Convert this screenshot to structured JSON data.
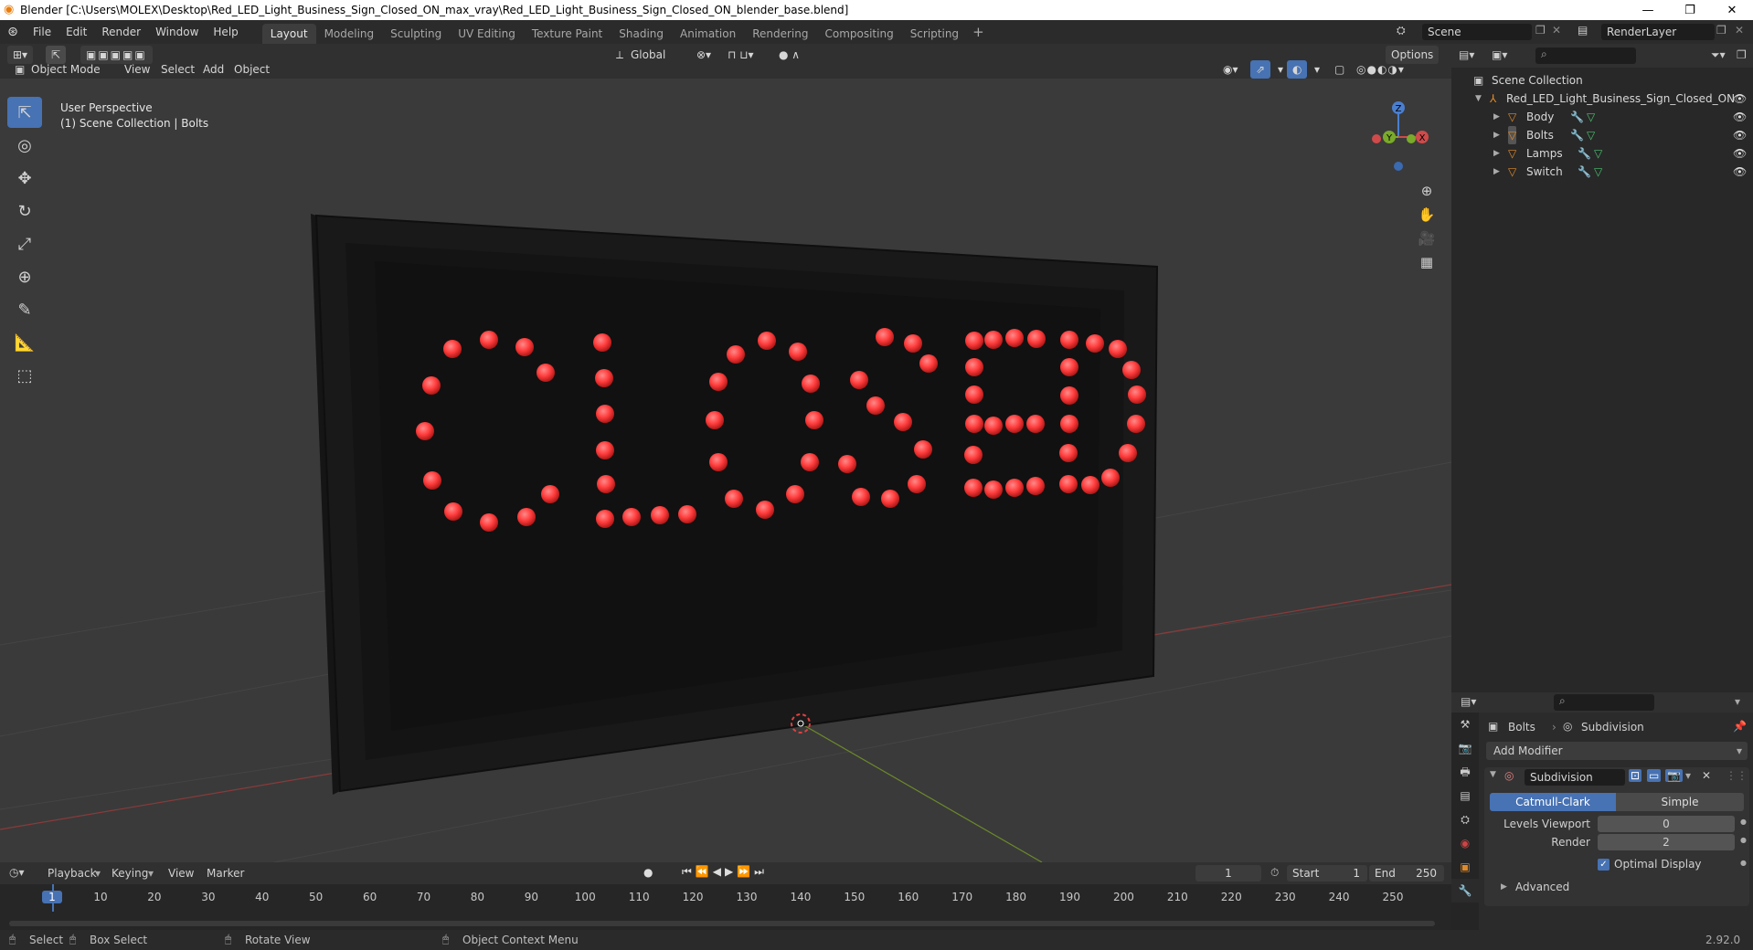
{
  "window": {
    "title": "Blender [C:\\Users\\MOLEX\\Desktop\\Red_LED_Light_Business_Sign_Closed_ON_max_vray\\Red_LED_Light_Business_Sign_Closed_ON_blender_base.blend]",
    "minimize": "—",
    "maximize": "❐",
    "close": "✕"
  },
  "menu": [
    "File",
    "Edit",
    "Render",
    "Window",
    "Help"
  ],
  "workspaces": [
    "Layout",
    "Modeling",
    "Sculpting",
    "UV Editing",
    "Texture Paint",
    "Shading",
    "Animation",
    "Rendering",
    "Compositing",
    "Scripting"
  ],
  "scene": {
    "name": "Scene",
    "render_layer": "RenderLayer"
  },
  "viewport": {
    "mode": "Object Mode",
    "menus": [
      "View",
      "Select",
      "Add",
      "Object"
    ],
    "transform_orientation": "Global",
    "options": "Options",
    "info_line1": "User Perspective",
    "info_line2": "(1) Scene Collection | Bolts",
    "gizmo": {
      "x": "X",
      "y": "Y",
      "z": "Z"
    },
    "sign_text": "CLOSED",
    "led_color": "#ff4040"
  },
  "outliner": {
    "root": "Scene Collection",
    "collection": "Red_LED_Light_Business_Sign_Closed_ON",
    "objects": [
      "Body",
      "Bolts",
      "Lamps",
      "Switch"
    ]
  },
  "properties": {
    "object": "Bolts",
    "modifier_name": "Subdivision",
    "add_modifier": "Add Modifier",
    "mod_types": [
      "Catmull-Clark",
      "Simple"
    ],
    "levels_viewport_label": "Levels Viewport",
    "levels_viewport": "0",
    "render_label": "Render",
    "render": "2",
    "optimal_display": "Optimal Display",
    "advanced": "Advanced"
  },
  "timeline": {
    "menus": [
      "Playback",
      "Keying",
      "View",
      "Marker"
    ],
    "current_frame": "1",
    "start_label": "Start",
    "start": "1",
    "end_label": "End",
    "end": "250",
    "ticks": [
      "1",
      "10",
      "20",
      "30",
      "40",
      "50",
      "60",
      "70",
      "80",
      "90",
      "100",
      "110",
      "120",
      "130",
      "140",
      "150",
      "160",
      "170",
      "180",
      "190",
      "200",
      "210",
      "220",
      "230",
      "240",
      "250"
    ]
  },
  "status": {
    "select": "Select",
    "box_select": "Box Select",
    "rotate": "Rotate View",
    "context_menu": "Object Context Menu",
    "version": "2.92.0"
  }
}
